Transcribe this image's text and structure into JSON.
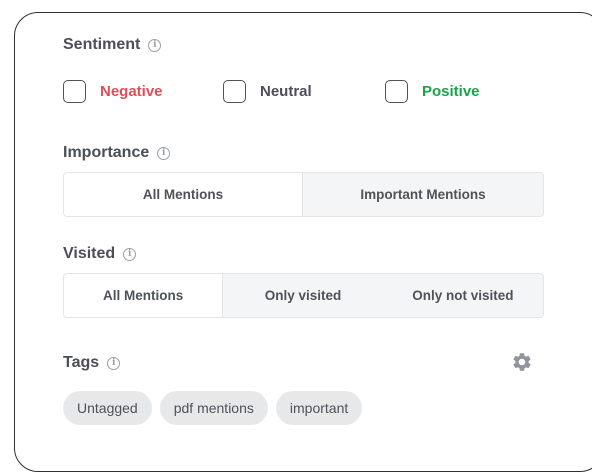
{
  "sentiment": {
    "title": "Sentiment",
    "options": [
      {
        "label": "Negative",
        "color": "#e04e5a",
        "checked": false
      },
      {
        "label": "Neutral",
        "color": "#4b4f56",
        "checked": false
      },
      {
        "label": "Positive",
        "color": "#1aa34a",
        "checked": false
      }
    ]
  },
  "importance": {
    "title": "Importance",
    "options": [
      "All Mentions",
      "Important Mentions"
    ],
    "selected": "All Mentions"
  },
  "visited": {
    "title": "Visited",
    "options": [
      "All Mentions",
      "Only visited",
      "Only not visited"
    ],
    "selected": "All Mentions"
  },
  "tags": {
    "title": "Tags",
    "settings_icon": "gear-icon",
    "items": [
      "Untagged",
      "pdf mentions",
      "important"
    ]
  },
  "info_icon": "info-icon"
}
